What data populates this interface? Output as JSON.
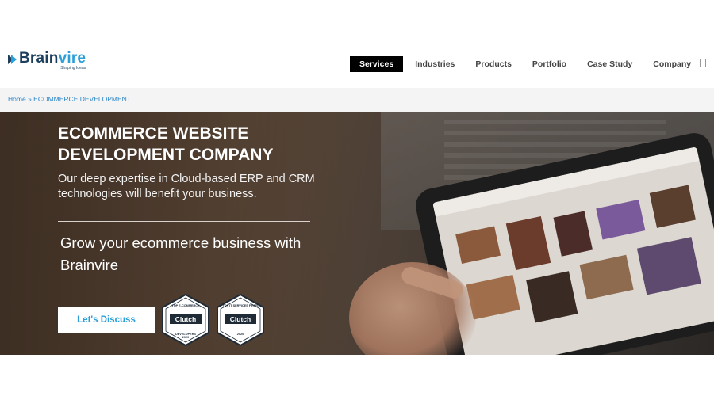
{
  "logo": {
    "word_part1": "Brain",
    "word_part2": "vire",
    "tagline": "Shaping Ideas"
  },
  "nav": {
    "items": [
      {
        "label": "Services",
        "active": true
      },
      {
        "label": "Industries",
        "active": false
      },
      {
        "label": "Products",
        "active": false
      },
      {
        "label": "Portfolio",
        "active": false
      },
      {
        "label": "Case Study",
        "active": false
      },
      {
        "label": "Company",
        "active": false
      }
    ],
    "menu_icon": "hamburger-icon"
  },
  "breadcrumb": {
    "home": "Home",
    "separator": "»",
    "current": "ECOMMERCE DEVELOPMENT"
  },
  "hero": {
    "title": "ECOMMERCE WEBSITE DEVELOPMENT COMPANY",
    "subtitle": "Our deep expertise in Cloud-based ERP and CRM technologies will benefit your business.",
    "grow_text": "Grow your ecommerce business with Brainvire",
    "cta_label": "Let's Discuss"
  },
  "badges": [
    {
      "top": "TOP E-COMMERCE",
      "brand": "Clutch",
      "bottom": "DEVELOPERS",
      "year": "2020"
    },
    {
      "top": "TOP IT SERVICES FIRMS",
      "brand": "Clutch",
      "bottom": "",
      "year": "2020"
    }
  ],
  "colors": {
    "brand_dark": "#1d3f5e",
    "brand_light": "#2a9fd8",
    "nav_active_bg": "#000000",
    "breadcrumb_link": "#2a85c7",
    "badge_navy": "#1e2a36"
  }
}
